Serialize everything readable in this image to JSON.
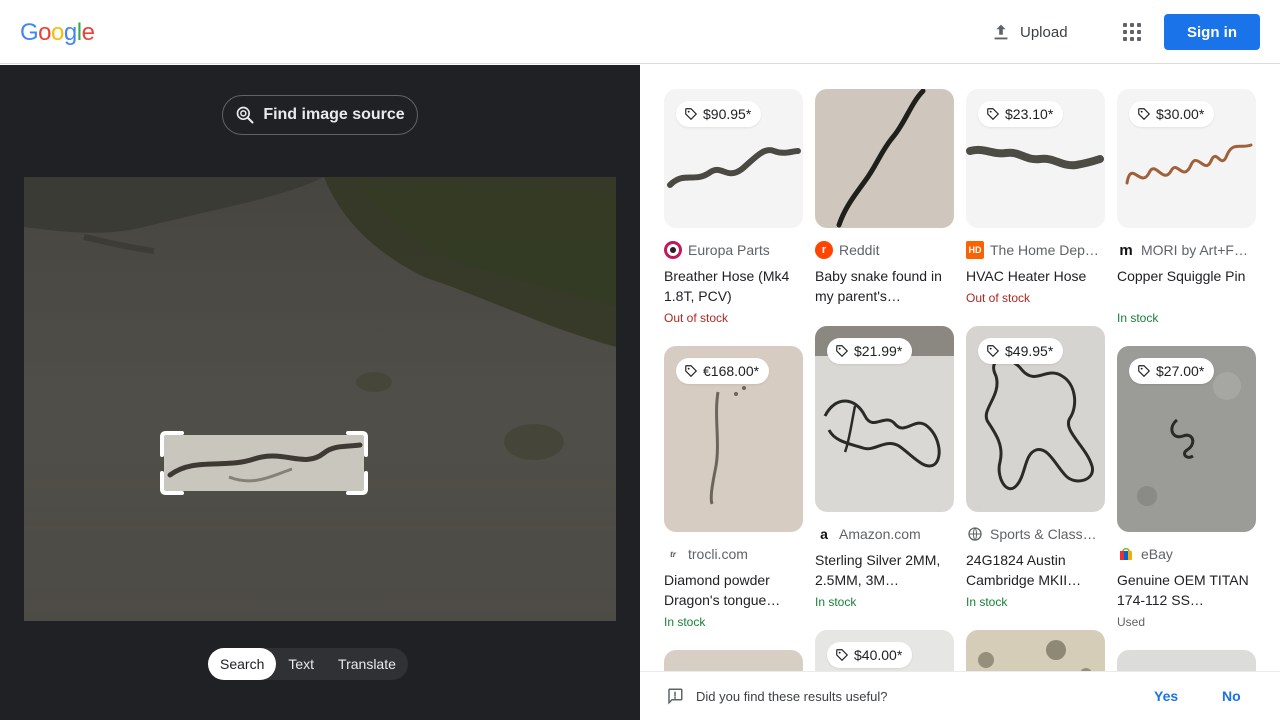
{
  "header": {
    "logo_letters": [
      "G",
      "o",
      "o",
      "g",
      "l",
      "e"
    ],
    "logo_colors": [
      "#4285f4",
      "#ea4335",
      "#fbbc05",
      "#4285f4",
      "#34a853",
      "#ea4335"
    ],
    "upload_label": "Upload",
    "signin_label": "Sign in"
  },
  "left": {
    "find_source_label": "Find image source",
    "modes": [
      "Search",
      "Text",
      "Translate"
    ],
    "active_mode": "Search"
  },
  "results": [
    {
      "price": "$90.95*",
      "source": "Europa Parts",
      "title": "Breather Hose (Mk4 1.8T, PCV)",
      "stock": "Out of stock"
    },
    {
      "price": "",
      "source": "Reddit",
      "title": "Baby snake found in my parent's…",
      "stock": ""
    },
    {
      "price": "$23.10*",
      "source": "The Home Dep…",
      "title": "HVAC Heater Hose",
      "stock": "Out of stock"
    },
    {
      "price": "$30.00*",
      "source": "MORI by Art+F…",
      "title": "Copper Squiggle Pin",
      "stock": "In stock"
    },
    {
      "price": "€168.00*",
      "source": "trocli.com",
      "title": "Diamond powder Dragon's tongue…",
      "stock": "In stock"
    },
    {
      "price": "$21.99*",
      "source": "Amazon.com",
      "title": "Sterling Silver 2MM, 2.5MM, 3M…",
      "stock": "In stock"
    },
    {
      "price": "$49.95*",
      "source": "Sports & Class…",
      "title": "24G1824 Austin Cambridge MKII…",
      "stock": "In stock"
    },
    {
      "price": "$27.00*",
      "source": "eBay",
      "title": "Genuine OEM TITAN 174-112 SS…",
      "stock": "Used"
    },
    {
      "price": "$40.00*"
    }
  ],
  "feedback": {
    "question": "Did you find these results useful?",
    "yes_label": "Yes",
    "no_label": "No"
  }
}
